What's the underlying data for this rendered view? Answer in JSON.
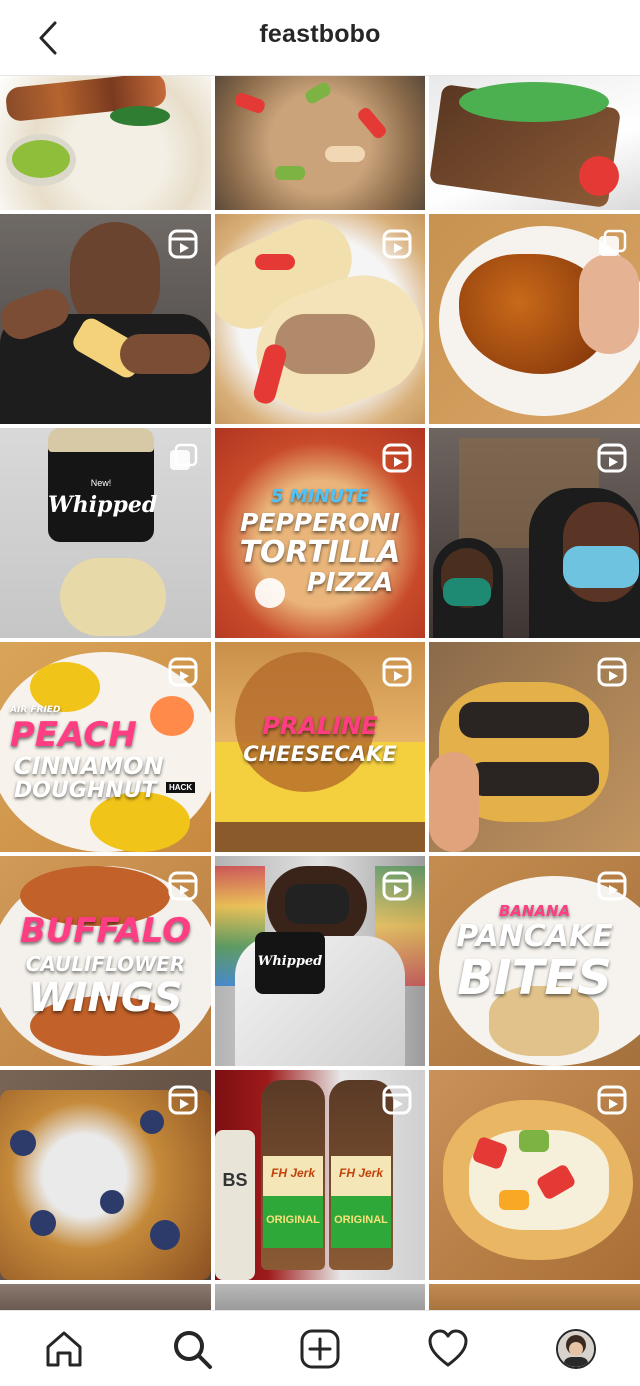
{
  "header": {
    "title": "feastbobo",
    "back_icon": "chevron-left-icon"
  },
  "colors": {
    "text": "#262626",
    "overlay_pink": "#ff3d82",
    "overlay_white": "#ffffff"
  },
  "posts": [
    {
      "type": "image",
      "caption": ""
    },
    {
      "type": "image",
      "caption": ""
    },
    {
      "type": "image",
      "caption": ""
    },
    {
      "type": "reel",
      "caption": ""
    },
    {
      "type": "reel",
      "caption": ""
    },
    {
      "type": "carousel",
      "caption": ""
    },
    {
      "type": "carousel",
      "caption": "",
      "label_line1": "New!",
      "label_line2": "Whipped"
    },
    {
      "type": "reel",
      "caption": "",
      "line1": "5 MINUTE",
      "line2": "PEPPERONI",
      "line3": "TORTILLA",
      "line4": "PIZZA"
    },
    {
      "type": "reel",
      "caption": ""
    },
    {
      "type": "reel",
      "caption": "",
      "line1": "AIR FRIED",
      "line2": "PEACH",
      "line3": "CINNAMON",
      "line4": "DOUGHNUT",
      "line5": "HACK"
    },
    {
      "type": "reel",
      "caption": "",
      "line1": "PRALINE",
      "line2": "CHEESECAKE"
    },
    {
      "type": "reel",
      "caption": ""
    },
    {
      "type": "reel",
      "caption": "",
      "line1": "BUFFALO",
      "line2": "CAULIFLOWER",
      "line3": "WINGS"
    },
    {
      "type": "reel",
      "caption": "",
      "label": "Whipped"
    },
    {
      "type": "reel",
      "caption": "",
      "line1": "BANANA",
      "line2": "PANCAKE",
      "line3": "BITES"
    },
    {
      "type": "reel",
      "caption": ""
    },
    {
      "type": "reel",
      "caption": "",
      "label_top": "FH Jerk",
      "label_bottom": "ORIGINAL"
    },
    {
      "type": "reel",
      "caption": ""
    }
  ],
  "bottom_nav": {
    "home_icon": "home-icon",
    "search_icon": "search-icon",
    "create_icon": "plus-square-icon",
    "activity_icon": "heart-icon",
    "profile_icon": "avatar"
  }
}
